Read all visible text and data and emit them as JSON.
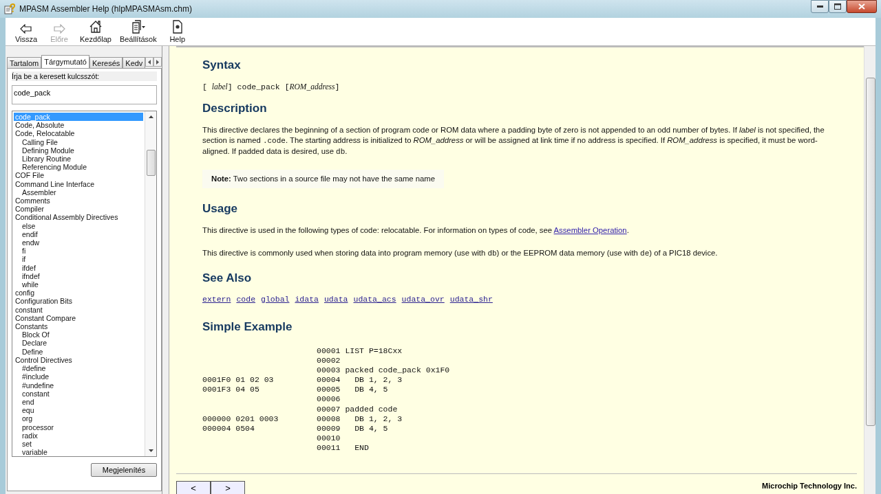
{
  "window": {
    "title": "MPASM Assembler Help (hlpMPASMAsm.chm)"
  },
  "toolbar": [
    {
      "label": "Vissza",
      "kind": "back",
      "disabled": false
    },
    {
      "label": "Előre",
      "kind": "forward",
      "disabled": true
    },
    {
      "label": "Kezdőlap",
      "kind": "home",
      "disabled": false
    },
    {
      "label": "Beállítások",
      "kind": "options",
      "disabled": false
    },
    {
      "label": "Help",
      "kind": "help",
      "disabled": false
    }
  ],
  "tabs": [
    {
      "label": "Tartalom",
      "selected": false
    },
    {
      "label": "Tárgymutató",
      "selected": true
    },
    {
      "label": "Keresés",
      "selected": false
    },
    {
      "label": "Kedv",
      "selected": false
    }
  ],
  "index": {
    "prompt": "Írja be a keresett kulcsszót:",
    "keyword": "code_pack",
    "items": [
      {
        "label": "code_pack",
        "selected": true
      },
      {
        "label": "Code, Absolute",
        "selected": false
      },
      {
        "label": "Code, Relocatable",
        "selected": false,
        "children": [
          {
            "label": "Calling File",
            "selected": false
          },
          {
            "label": "Defining Module",
            "selected": false
          },
          {
            "label": "Library Routine",
            "selected": false
          },
          {
            "label": "Referencing Module",
            "selected": false
          }
        ]
      },
      {
        "label": "COF File",
        "selected": false
      },
      {
        "label": "Command Line Interface",
        "selected": false,
        "children": [
          {
            "label": "Assembler",
            "selected": false
          }
        ]
      },
      {
        "label": "Comments",
        "selected": false
      },
      {
        "label": "Compiler",
        "selected": false
      },
      {
        "label": "Conditional Assembly Directives",
        "selected": false,
        "children": [
          {
            "label": "else",
            "selected": false
          },
          {
            "label": "endif",
            "selected": false
          },
          {
            "label": "endw",
            "selected": false
          },
          {
            "label": "fi",
            "selected": false
          },
          {
            "label": "if",
            "selected": false
          },
          {
            "label": "ifdef",
            "selected": false
          },
          {
            "label": "ifndef",
            "selected": false
          },
          {
            "label": "while",
            "selected": false
          }
        ]
      },
      {
        "label": "config",
        "selected": false
      },
      {
        "label": "Configuration Bits",
        "selected": false
      },
      {
        "label": "constant",
        "selected": false
      },
      {
        "label": "Constant Compare",
        "selected": false
      },
      {
        "label": "Constants",
        "selected": false,
        "children": [
          {
            "label": "Block Of",
            "selected": false
          },
          {
            "label": "Declare",
            "selected": false
          },
          {
            "label": "Define",
            "selected": false
          }
        ]
      },
      {
        "label": "Control Directives",
        "selected": false,
        "children": [
          {
            "label": "#define",
            "selected": false
          },
          {
            "label": "#include",
            "selected": false
          },
          {
            "label": "#undefine",
            "selected": false
          },
          {
            "label": "constant",
            "selected": false
          },
          {
            "label": "end",
            "selected": false
          },
          {
            "label": "equ",
            "selected": false
          },
          {
            "label": "org",
            "selected": false
          },
          {
            "label": "processor",
            "selected": false
          },
          {
            "label": "radix",
            "selected": false
          },
          {
            "label": "set",
            "selected": false
          },
          {
            "label": "variable",
            "selected": false
          }
        ]
      }
    ],
    "display_button": "Megjelenítés"
  },
  "content": {
    "sections": [
      {
        "heading": "Syntax",
        "blocks": [
          {
            "kind": "syntax",
            "runs": [
              {
                "kind": "text",
                "text": "[ "
              },
              {
                "kind": "italic",
                "text": "label"
              },
              {
                "kind": "text",
                "text": "] code_pack ["
              },
              {
                "kind": "italic",
                "text": "ROM_address"
              },
              {
                "kind": "text",
                "text": "]"
              }
            ]
          }
        ]
      },
      {
        "heading": "Description",
        "blocks": [
          {
            "kind": "paragraph",
            "runs": [
              {
                "kind": "text",
                "text": "This directive declares the beginning of a section of program code or ROM data where a padding byte of zero is not appended to an odd number of bytes. If "
              },
              {
                "kind": "italic",
                "text": "label"
              },
              {
                "kind": "text",
                "text": " is not specified, the section is named "
              },
              {
                "kind": "code",
                "text": ".code"
              },
              {
                "kind": "text",
                "text": ". The starting address is initialized to "
              },
              {
                "kind": "italic",
                "text": "ROM_address"
              },
              {
                "kind": "text",
                "text": " or will be assigned at link time if no address is specified. If "
              },
              {
                "kind": "italic",
                "text": "ROM_address"
              },
              {
                "kind": "text",
                "text": " is specified, it must be word-aligned. If padded data is desired, use "
              },
              {
                "kind": "code",
                "text": "db"
              },
              {
                "kind": "text",
                "text": "."
              }
            ]
          },
          {
            "kind": "note",
            "runs": [
              {
                "kind": "bold",
                "text": "Note:"
              },
              {
                "kind": "text",
                "text": " Two sections in a source file may not have the same name"
              }
            ]
          }
        ]
      },
      {
        "heading": "Usage",
        "blocks": [
          {
            "kind": "paragraph",
            "runs": [
              {
                "kind": "text",
                "text": "This directive is used in the following types of code: relocatable. For information on types of code, see "
              },
              {
                "kind": "link",
                "text": "Assembler Operation"
              },
              {
                "kind": "text",
                "text": "."
              }
            ]
          },
          {
            "kind": "paragraph",
            "runs": [
              {
                "kind": "text",
                "text": "This directive is commonly used when storing data into program memory (use with "
              },
              {
                "kind": "code",
                "text": "db"
              },
              {
                "kind": "text",
                "text": ") or the EEPROM data memory (use with "
              },
              {
                "kind": "code",
                "text": "de"
              },
              {
                "kind": "text",
                "text": ") of a PIC18 device."
              }
            ]
          }
        ]
      },
      {
        "heading": "See Also",
        "blocks": [
          {
            "kind": "links",
            "links": [
              "extern",
              "code",
              "global",
              "idata",
              "udata",
              "udata_acs",
              "udata_ovr",
              "udata_shr"
            ]
          }
        ]
      },
      {
        "heading": "Simple Example",
        "blocks": [
          {
            "kind": "listing",
            "rows": [
              {
                "object": "",
                "source": "00001 LIST P=18Cxx"
              },
              {
                "object": "",
                "source": "00002"
              },
              {
                "object": "",
                "source": "00003 packed code_pack 0x1F0"
              },
              {
                "object": "0001F0 01 02 03",
                "source": "00004   DB 1, 2, 3"
              },
              {
                "object": "0001F3 04 05",
                "source": "00005   DB 4, 5"
              },
              {
                "object": "",
                "source": "00006"
              },
              {
                "object": "",
                "source": "00007 padded code"
              },
              {
                "object": "000000 0201 0003",
                "source": "00008   DB 1, 2, 3"
              },
              {
                "object": "000004 0504",
                "source": "00009   DB 4, 5"
              },
              {
                "object": "",
                "source": "00010"
              },
              {
                "object": "",
                "source": "00011   END"
              }
            ]
          }
        ]
      }
    ],
    "nav_buttons": [
      "<",
      ">"
    ],
    "footer": "Microchip Technology Inc."
  }
}
